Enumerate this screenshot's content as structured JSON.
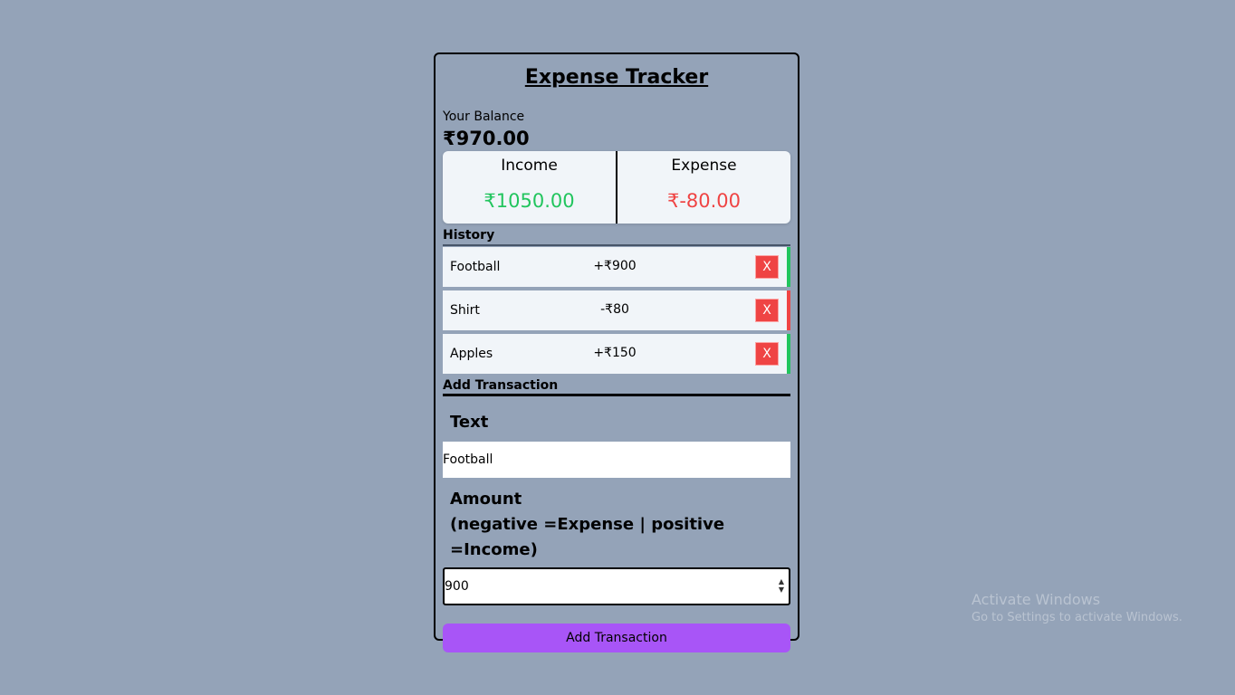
{
  "app": {
    "title": "Expense Tracker"
  },
  "balance": {
    "label": "Your Balance",
    "value": "₹970.00"
  },
  "summary": {
    "income_label": "Income",
    "income_value": "₹1050.00",
    "expense_label": "Expense",
    "expense_value": "₹-80.00"
  },
  "history": {
    "heading": "History",
    "items": [
      {
        "text": "Football",
        "amount": "+₹900",
        "type": "plus",
        "delete_label": "X"
      },
      {
        "text": "Shirt",
        "amount": "-₹80",
        "type": "minus",
        "delete_label": "X"
      },
      {
        "text": "Apples",
        "amount": "+₹150",
        "type": "plus",
        "delete_label": "X"
      }
    ]
  },
  "form": {
    "heading": "Add Transaction",
    "text_label": "Text",
    "text_value": "Football",
    "amount_label": "Amount",
    "amount_hint": "(negative =Expense | positive =Income)",
    "amount_value": "900",
    "submit_label": "Add Transaction"
  },
  "watermark": {
    "title": "Activate Windows",
    "subtitle": "Go to Settings to activate Windows."
  },
  "colors": {
    "background": "#94a3b8",
    "income": "#22c55e",
    "expense": "#ef4444",
    "accent": "#a855f7"
  }
}
